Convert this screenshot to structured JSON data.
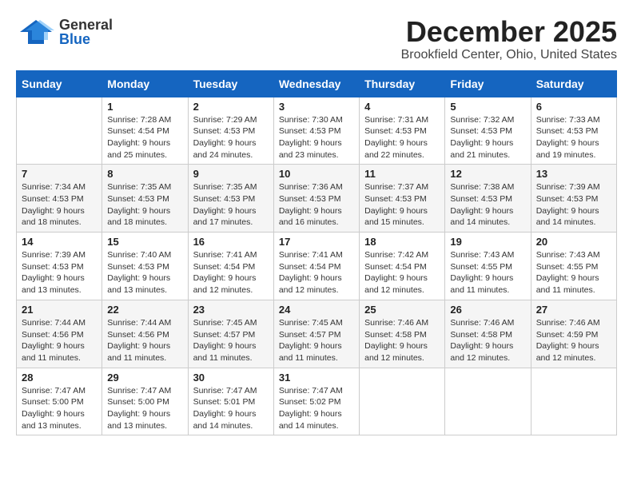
{
  "header": {
    "logo_general": "General",
    "logo_blue": "Blue",
    "month_title": "December 2025",
    "subtitle": "Brookfield Center, Ohio, United States"
  },
  "weekdays": [
    "Sunday",
    "Monday",
    "Tuesday",
    "Wednesday",
    "Thursday",
    "Friday",
    "Saturday"
  ],
  "weeks": [
    [
      {
        "day": "",
        "info": ""
      },
      {
        "day": "1",
        "info": "Sunrise: 7:28 AM\nSunset: 4:54 PM\nDaylight: 9 hours\nand 25 minutes."
      },
      {
        "day": "2",
        "info": "Sunrise: 7:29 AM\nSunset: 4:53 PM\nDaylight: 9 hours\nand 24 minutes."
      },
      {
        "day": "3",
        "info": "Sunrise: 7:30 AM\nSunset: 4:53 PM\nDaylight: 9 hours\nand 23 minutes."
      },
      {
        "day": "4",
        "info": "Sunrise: 7:31 AM\nSunset: 4:53 PM\nDaylight: 9 hours\nand 22 minutes."
      },
      {
        "day": "5",
        "info": "Sunrise: 7:32 AM\nSunset: 4:53 PM\nDaylight: 9 hours\nand 21 minutes."
      },
      {
        "day": "6",
        "info": "Sunrise: 7:33 AM\nSunset: 4:53 PM\nDaylight: 9 hours\nand 19 minutes."
      }
    ],
    [
      {
        "day": "7",
        "info": "Sunrise: 7:34 AM\nSunset: 4:53 PM\nDaylight: 9 hours\nand 18 minutes."
      },
      {
        "day": "8",
        "info": "Sunrise: 7:35 AM\nSunset: 4:53 PM\nDaylight: 9 hours\nand 18 minutes."
      },
      {
        "day": "9",
        "info": "Sunrise: 7:35 AM\nSunset: 4:53 PM\nDaylight: 9 hours\nand 17 minutes."
      },
      {
        "day": "10",
        "info": "Sunrise: 7:36 AM\nSunset: 4:53 PM\nDaylight: 9 hours\nand 16 minutes."
      },
      {
        "day": "11",
        "info": "Sunrise: 7:37 AM\nSunset: 4:53 PM\nDaylight: 9 hours\nand 15 minutes."
      },
      {
        "day": "12",
        "info": "Sunrise: 7:38 AM\nSunset: 4:53 PM\nDaylight: 9 hours\nand 14 minutes."
      },
      {
        "day": "13",
        "info": "Sunrise: 7:39 AM\nSunset: 4:53 PM\nDaylight: 9 hours\nand 14 minutes."
      }
    ],
    [
      {
        "day": "14",
        "info": "Sunrise: 7:39 AM\nSunset: 4:53 PM\nDaylight: 9 hours\nand 13 minutes."
      },
      {
        "day": "15",
        "info": "Sunrise: 7:40 AM\nSunset: 4:53 PM\nDaylight: 9 hours\nand 13 minutes."
      },
      {
        "day": "16",
        "info": "Sunrise: 7:41 AM\nSunset: 4:54 PM\nDaylight: 9 hours\nand 12 minutes."
      },
      {
        "day": "17",
        "info": "Sunrise: 7:41 AM\nSunset: 4:54 PM\nDaylight: 9 hours\nand 12 minutes."
      },
      {
        "day": "18",
        "info": "Sunrise: 7:42 AM\nSunset: 4:54 PM\nDaylight: 9 hours\nand 12 minutes."
      },
      {
        "day": "19",
        "info": "Sunrise: 7:43 AM\nSunset: 4:55 PM\nDaylight: 9 hours\nand 11 minutes."
      },
      {
        "day": "20",
        "info": "Sunrise: 7:43 AM\nSunset: 4:55 PM\nDaylight: 9 hours\nand 11 minutes."
      }
    ],
    [
      {
        "day": "21",
        "info": "Sunrise: 7:44 AM\nSunset: 4:56 PM\nDaylight: 9 hours\nand 11 minutes."
      },
      {
        "day": "22",
        "info": "Sunrise: 7:44 AM\nSunset: 4:56 PM\nDaylight: 9 hours\nand 11 minutes."
      },
      {
        "day": "23",
        "info": "Sunrise: 7:45 AM\nSunset: 4:57 PM\nDaylight: 9 hours\nand 11 minutes."
      },
      {
        "day": "24",
        "info": "Sunrise: 7:45 AM\nSunset: 4:57 PM\nDaylight: 9 hours\nand 11 minutes."
      },
      {
        "day": "25",
        "info": "Sunrise: 7:46 AM\nSunset: 4:58 PM\nDaylight: 9 hours\nand 12 minutes."
      },
      {
        "day": "26",
        "info": "Sunrise: 7:46 AM\nSunset: 4:58 PM\nDaylight: 9 hours\nand 12 minutes."
      },
      {
        "day": "27",
        "info": "Sunrise: 7:46 AM\nSunset: 4:59 PM\nDaylight: 9 hours\nand 12 minutes."
      }
    ],
    [
      {
        "day": "28",
        "info": "Sunrise: 7:47 AM\nSunset: 5:00 PM\nDaylight: 9 hours\nand 13 minutes."
      },
      {
        "day": "29",
        "info": "Sunrise: 7:47 AM\nSunset: 5:00 PM\nDaylight: 9 hours\nand 13 minutes."
      },
      {
        "day": "30",
        "info": "Sunrise: 7:47 AM\nSunset: 5:01 PM\nDaylight: 9 hours\nand 14 minutes."
      },
      {
        "day": "31",
        "info": "Sunrise: 7:47 AM\nSunset: 5:02 PM\nDaylight: 9 hours\nand 14 minutes."
      },
      {
        "day": "",
        "info": ""
      },
      {
        "day": "",
        "info": ""
      },
      {
        "day": "",
        "info": ""
      }
    ]
  ]
}
